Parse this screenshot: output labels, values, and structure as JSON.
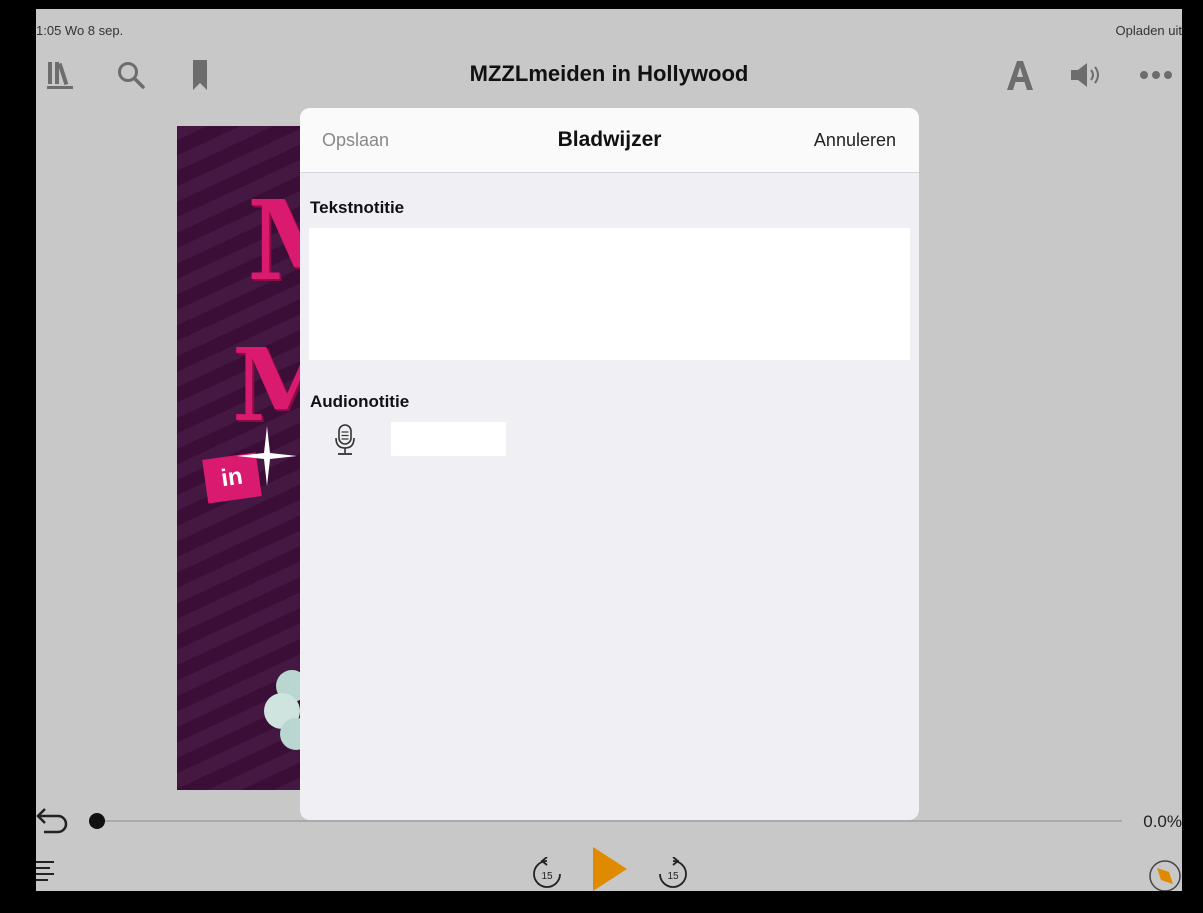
{
  "status": {
    "left": "1:05  Wo 8 sep.",
    "right": "Opladen uit"
  },
  "toolbar": {
    "title": "MZZLmeiden in Hollywood",
    "icons": [
      "library-icon",
      "search-icon",
      "bookmark-icon",
      "font-icon",
      "speaker-icon",
      "more-icon"
    ]
  },
  "cover": {
    "letters": "M M",
    "badge": "in"
  },
  "modal": {
    "save_label": "Opslaan",
    "title": "Bladwijzer",
    "cancel_label": "Annuleren",
    "text_note_label": "Tekstnotitie",
    "text_note_value": "",
    "audio_note_label": "Audionotitie"
  },
  "player": {
    "progress_text": "0.0%",
    "progress_fraction": 0.0,
    "skip_back_seconds": "15",
    "skip_forward_seconds": "15"
  },
  "colors": {
    "accent": "#e08a00",
    "cover": "#3d0f3a",
    "cover_text": "#d91a6f"
  }
}
